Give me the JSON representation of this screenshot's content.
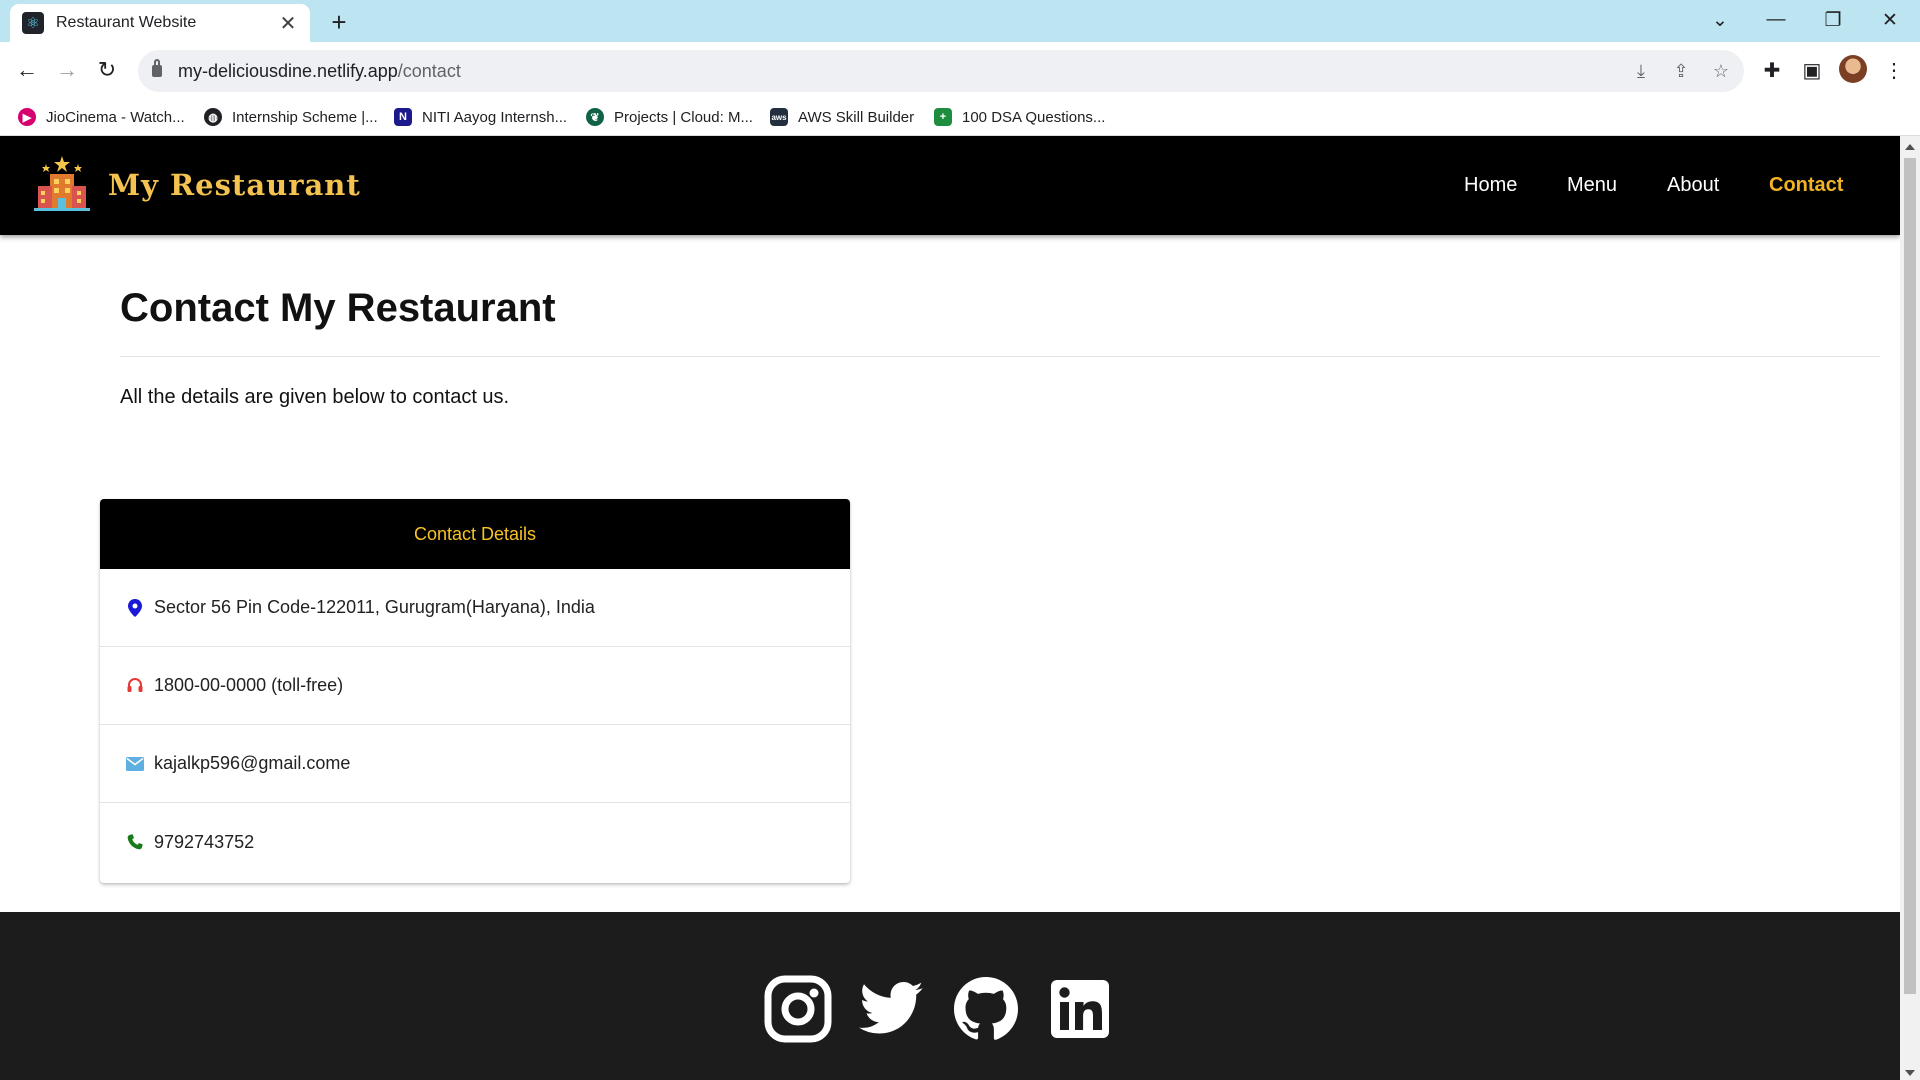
{
  "browser": {
    "tab_title": "Restaurant Website",
    "url_host": "my-deliciousdine.netlify.app",
    "url_path": "/contact",
    "bookmarks": [
      {
        "label": "JioCinema - Watch...",
        "icon": "jiocinema-icon",
        "color": "#d6006e"
      },
      {
        "label": "Internship Scheme |...",
        "icon": "globe-icon",
        "color": "#202124"
      },
      {
        "label": "NITI Aayog Internsh...",
        "icon": "notion-icon",
        "color": "#1a1a8c"
      },
      {
        "label": "Projects | Cloud: M...",
        "icon": "mongodb-leaf-icon",
        "color": "#116149"
      },
      {
        "label": "AWS Skill Builder",
        "icon": "aws-icon",
        "color": "#232f3e"
      },
      {
        "label": "100 DSA Questions...",
        "icon": "sheets-icon",
        "color": "#1e8e3e"
      }
    ]
  },
  "site": {
    "brand": "My Restaurant",
    "nav": [
      {
        "label": "Home",
        "active": false
      },
      {
        "label": "Menu",
        "active": false
      },
      {
        "label": "About",
        "active": false
      },
      {
        "label": "Contact",
        "active": true
      }
    ],
    "accent": "#f0b323"
  },
  "main": {
    "title": "Contact My Restaurant",
    "lead": "All the details are given below to contact us.",
    "card": {
      "heading": "Contact Details",
      "rows": [
        {
          "icon": "location-pin-icon",
          "color": "#1a1ad6",
          "text": "Sector 56 Pin Code-122011, Gurugram(Haryana), India"
        },
        {
          "icon": "headset-icon",
          "color": "#e53935",
          "text": "1800-00-0000 (toll-free)"
        },
        {
          "icon": "mail-icon",
          "color": "#5fb0e0",
          "text": "kajalkp596@gmail.come"
        },
        {
          "icon": "phone-icon",
          "color": "#1b7a1b",
          "text": "9792743752"
        }
      ]
    }
  },
  "footer": {
    "social_icons": [
      "instagram-icon",
      "twitter-icon",
      "github-icon",
      "linkedin-icon"
    ]
  }
}
